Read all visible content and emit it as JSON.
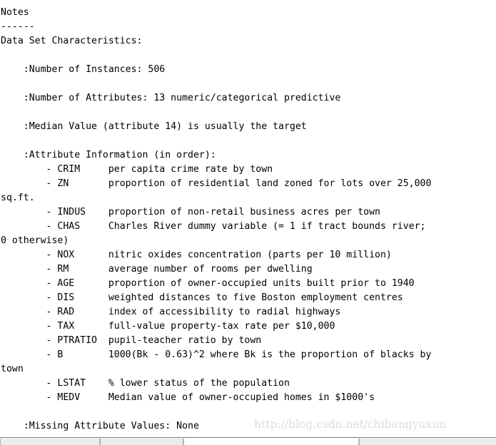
{
  "document": {
    "title": "Notes",
    "underline": "------",
    "lines": [
      "Notes",
      "------",
      "Data Set Characteristics:  ",
      "",
      "    :Number of Instances: 506 ",
      "",
      "    :Number of Attributes: 13 numeric/categorical predictive",
      "    ",
      "    :Median Value (attribute 14) is usually the target",
      "",
      "    :Attribute Information (in order):",
      "        - CRIM     per capita crime rate by town",
      "        - ZN       proportion of residential land zoned for lots over 25,000",
      "sq.ft.",
      "        - INDUS    proportion of non-retail business acres per town",
      "        - CHAS     Charles River dummy variable (= 1 if tract bounds river;",
      "0 otherwise)",
      "        - NOX      nitric oxides concentration (parts per 10 million)",
      "        - RM       average number of rooms per dwelling",
      "        - AGE      proportion of owner-occupied units built prior to 1940",
      "        - DIS      weighted distances to five Boston employment centres",
      "        - RAD      index of accessibility to radial highways",
      "        - TAX      full-value property-tax rate per $10,000",
      "        - PTRATIO  pupil-teacher ratio by town",
      "        - B        1000(Bk - 0.63)^2 where Bk is the proportion of blacks by",
      "town",
      "        - LSTAT    % lower status of the population",
      "        - MEDV     Median value of owner-occupied homes in $1000's",
      "",
      "    :Missing Attribute Values: None"
    ],
    "sections": {
      "characteristics_heading": "Data Set Characteristics:",
      "number_of_instances_label": ":Number of Instances:",
      "number_of_instances_value": "506",
      "number_of_attributes_label": ":Number of Attributes:",
      "number_of_attributes_value": "13 numeric/categorical predictive",
      "median_value_note": ":Median Value (attribute 14) is usually the target",
      "attribute_information_heading": ":Attribute Information (in order):",
      "missing_attribute_values_label": ":Missing Attribute Values:",
      "missing_attribute_values_value": "None"
    },
    "attributes": [
      {
        "name": "CRIM",
        "description": "per capita crime rate by town"
      },
      {
        "name": "ZN",
        "description": "proportion of residential land zoned for lots over 25,000 sq.ft."
      },
      {
        "name": "INDUS",
        "description": "proportion of non-retail business acres per town"
      },
      {
        "name": "CHAS",
        "description": "Charles River dummy variable (= 1 if tract bounds river; 0 otherwise)"
      },
      {
        "name": "NOX",
        "description": "nitric oxides concentration (parts per 10 million)"
      },
      {
        "name": "RM",
        "description": "average number of rooms per dwelling"
      },
      {
        "name": "AGE",
        "description": "proportion of owner-occupied units built prior to 1940"
      },
      {
        "name": "DIS",
        "description": "weighted distances to five Boston employment centres"
      },
      {
        "name": "RAD",
        "description": "index of accessibility to radial highways"
      },
      {
        "name": "TAX",
        "description": "full-value property-tax rate per $10,000"
      },
      {
        "name": "PTRATIO",
        "description": "pupil-teacher ratio by town"
      },
      {
        "name": "B",
        "description": "1000(Bk - 0.63)^2 where Bk is the proportion of blacks by town"
      },
      {
        "name": "LSTAT",
        "description": "% lower status of the population"
      },
      {
        "name": "MEDV",
        "description": "Median value of owner-occupied homes in $1000's"
      }
    ],
    "body_text": "Notes\n------\nData Set Characteristics:  \n\n    :Number of Instances: 506 \n\n    :Number of Attributes: 13 numeric/categorical predictive\n    \n    :Median Value (attribute 14) is usually the target\n\n    :Attribute Information (in order):\n        - CRIM     per capita crime rate by town\n        - ZN       proportion of residential land zoned for lots over 25,000\nsq.ft.\n        - INDUS    proportion of non-retail business acres per town\n        - CHAS     Charles River dummy variable (= 1 if tract bounds river;\n0 otherwise)\n        - NOX      nitric oxides concentration (parts per 10 million)\n        - RM       average number of rooms per dwelling\n        - AGE      proportion of owner-occupied units built prior to 1940\n        - DIS      weighted distances to five Boston employment centres\n        - RAD      index of accessibility to radial highways\n        - TAX      full-value property-tax rate per $10,000\n        - PTRATIO  pupil-teacher ratio by town\n        - B        1000(Bk - 0.63)^2 where Bk is the proportion of blacks by\ntown\n        - LSTAT    % lower status of the population\n        - MEDV     Median value of owner-occupied homes in $1000's\n\n    :Missing Attribute Values: None"
  },
  "watermark": {
    "text": "http://blog.csdn.net/chibangyuxun",
    "color": "#dcdcdc"
  },
  "statusbar": {
    "cells": [
      "",
      "",
      "",
      "",
      ""
    ]
  },
  "colors": {
    "background": "#ffffff",
    "text": "#000000",
    "watermark": "#dcdcdc",
    "statusbar_rule": "#7a7a7a",
    "statusbar_cell": "#ececed",
    "statusbar_cell_border": "#b4b4b4"
  }
}
